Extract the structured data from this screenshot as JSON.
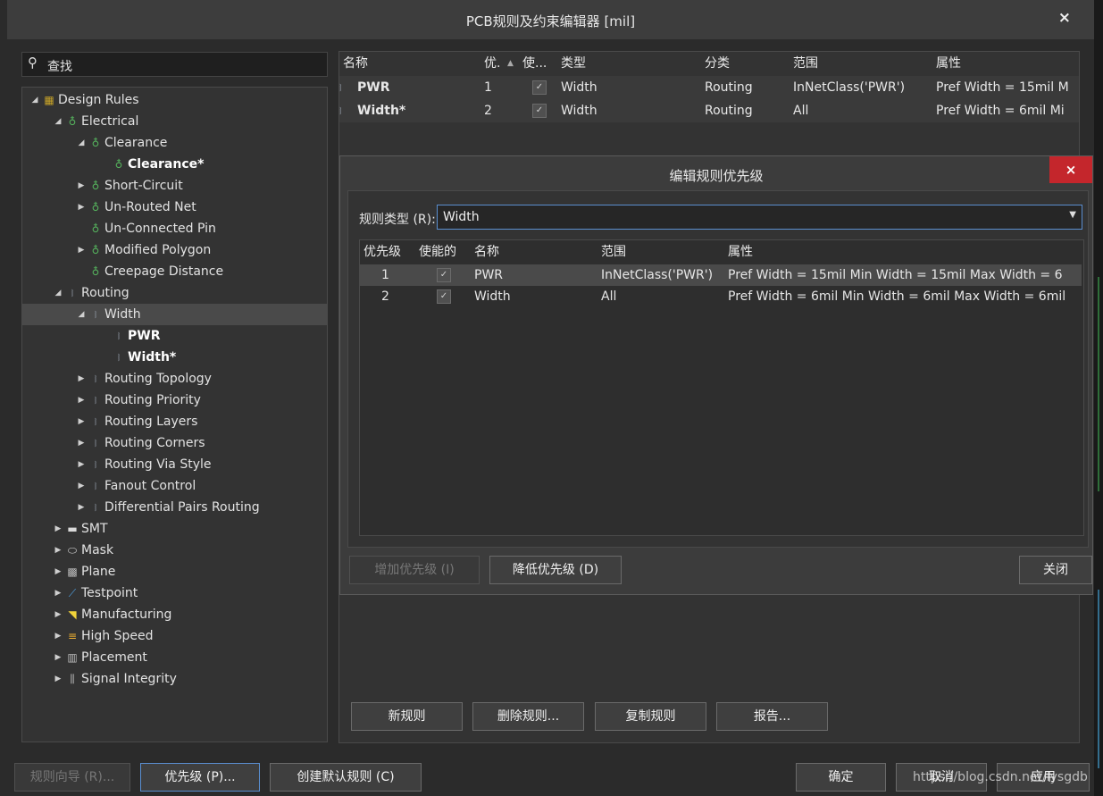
{
  "window": {
    "title": "PCB规则及约束编辑器 [mil]",
    "close_glyph": "×"
  },
  "search": {
    "icon": "search-icon",
    "placeholder": "查找"
  },
  "tree": {
    "nodes": [
      {
        "label": "Design Rules",
        "arrow": "◢",
        "icon": "▦"
      },
      {
        "label": "Electrical",
        "arrow": "◢",
        "icon": "♁"
      },
      {
        "label": "Clearance",
        "arrow": "◢",
        "icon": "♁"
      },
      {
        "label": "Clearance*",
        "arrow": "",
        "icon": "♁"
      },
      {
        "label": "Short-Circuit",
        "arrow": "▶",
        "icon": "♁"
      },
      {
        "label": "Un-Routed Net",
        "arrow": "▶",
        "icon": "♁"
      },
      {
        "label": "Un-Connected Pin",
        "arrow": "",
        "icon": "♁"
      },
      {
        "label": "Modified Polygon",
        "arrow": "▶",
        "icon": "♁"
      },
      {
        "label": "Creepage Distance",
        "arrow": "",
        "icon": "♁"
      },
      {
        "label": "Routing",
        "arrow": "◢",
        "icon": "⧘"
      },
      {
        "label": "Width",
        "arrow": "◢",
        "icon": "⧘"
      },
      {
        "label": "PWR",
        "arrow": "",
        "icon": "⧘"
      },
      {
        "label": "Width*",
        "arrow": "",
        "icon": "⧘"
      },
      {
        "label": "Routing Topology",
        "arrow": "▶",
        "icon": "⧘"
      },
      {
        "label": "Routing Priority",
        "arrow": "▶",
        "icon": "⧘"
      },
      {
        "label": "Routing Layers",
        "arrow": "▶",
        "icon": "⧘"
      },
      {
        "label": "Routing Corners",
        "arrow": "▶",
        "icon": "⧘"
      },
      {
        "label": "Routing Via Style",
        "arrow": "▶",
        "icon": "⧘"
      },
      {
        "label": "Fanout Control",
        "arrow": "▶",
        "icon": "⧘"
      },
      {
        "label": "Differential Pairs Routing",
        "arrow": "▶",
        "icon": "⧘"
      },
      {
        "label": "SMT",
        "arrow": "▶",
        "icon": "▬"
      },
      {
        "label": "Mask",
        "arrow": "▶",
        "icon": "⬭"
      },
      {
        "label": "Plane",
        "arrow": "▶",
        "icon": "▩"
      },
      {
        "label": "Testpoint",
        "arrow": "▶",
        "icon": "⟋"
      },
      {
        "label": "Manufacturing",
        "arrow": "▶",
        "icon": "◥"
      },
      {
        "label": "High Speed",
        "arrow": "▶",
        "icon": "≡"
      },
      {
        "label": "Placement",
        "arrow": "▶",
        "icon": "▥"
      },
      {
        "label": "Signal Integrity",
        "arrow": "▶",
        "icon": "⫼"
      }
    ]
  },
  "rule_grid": {
    "headers": [
      "名称",
      "优.",
      "使...",
      "类型",
      "分类",
      "范围",
      "属性"
    ],
    "sort_glyph": "▲",
    "rows": [
      {
        "name": "PWR",
        "priority": "1",
        "enabled": "✓",
        "type": "Width",
        "category": "Routing",
        "scope": "InNetClass('PWR')",
        "attrs": "Pref Width = 15mil   M"
      },
      {
        "name": "Width*",
        "priority": "2",
        "enabled": "✓",
        "type": "Width",
        "category": "Routing",
        "scope": "All",
        "attrs": "Pref Width = 6mil   Mi"
      }
    ]
  },
  "modal": {
    "title": "编辑规则优先级",
    "close_glyph": "×",
    "rule_type_label": "规则类型 (R):",
    "rule_type_value": "Width",
    "headers": [
      "优先级",
      "使能的",
      "名称",
      "范围",
      "属性"
    ],
    "rows": [
      {
        "priority": "1",
        "enabled": "✓",
        "name": "PWR",
        "scope": "InNetClass('PWR')",
        "attrs": "Pref Width = 15mil   Min Width = 15mil   Max Width = 6"
      },
      {
        "priority": "2",
        "enabled": "✓",
        "name": "Width",
        "scope": "All",
        "attrs": "Pref Width = 6mil   Min Width = 6mil   Max Width = 6mil"
      }
    ],
    "increase_label": "增加优先级 (I)",
    "decrease_label": "降低优先级 (D)",
    "close_label": "关闭"
  },
  "grid_buttons": {
    "new": "新规则",
    "delete": "删除规则...",
    "copy": "复制规则",
    "report": "报告..."
  },
  "footer": {
    "wizard": "规则向导 (R)...",
    "priority": "优先级 (P)...",
    "create_default": "创建默认规则 (C)",
    "ok": "确定",
    "cancel": "取消",
    "apply": "应用",
    "watermark": "https://blog.csdn.net/lysgdb"
  }
}
